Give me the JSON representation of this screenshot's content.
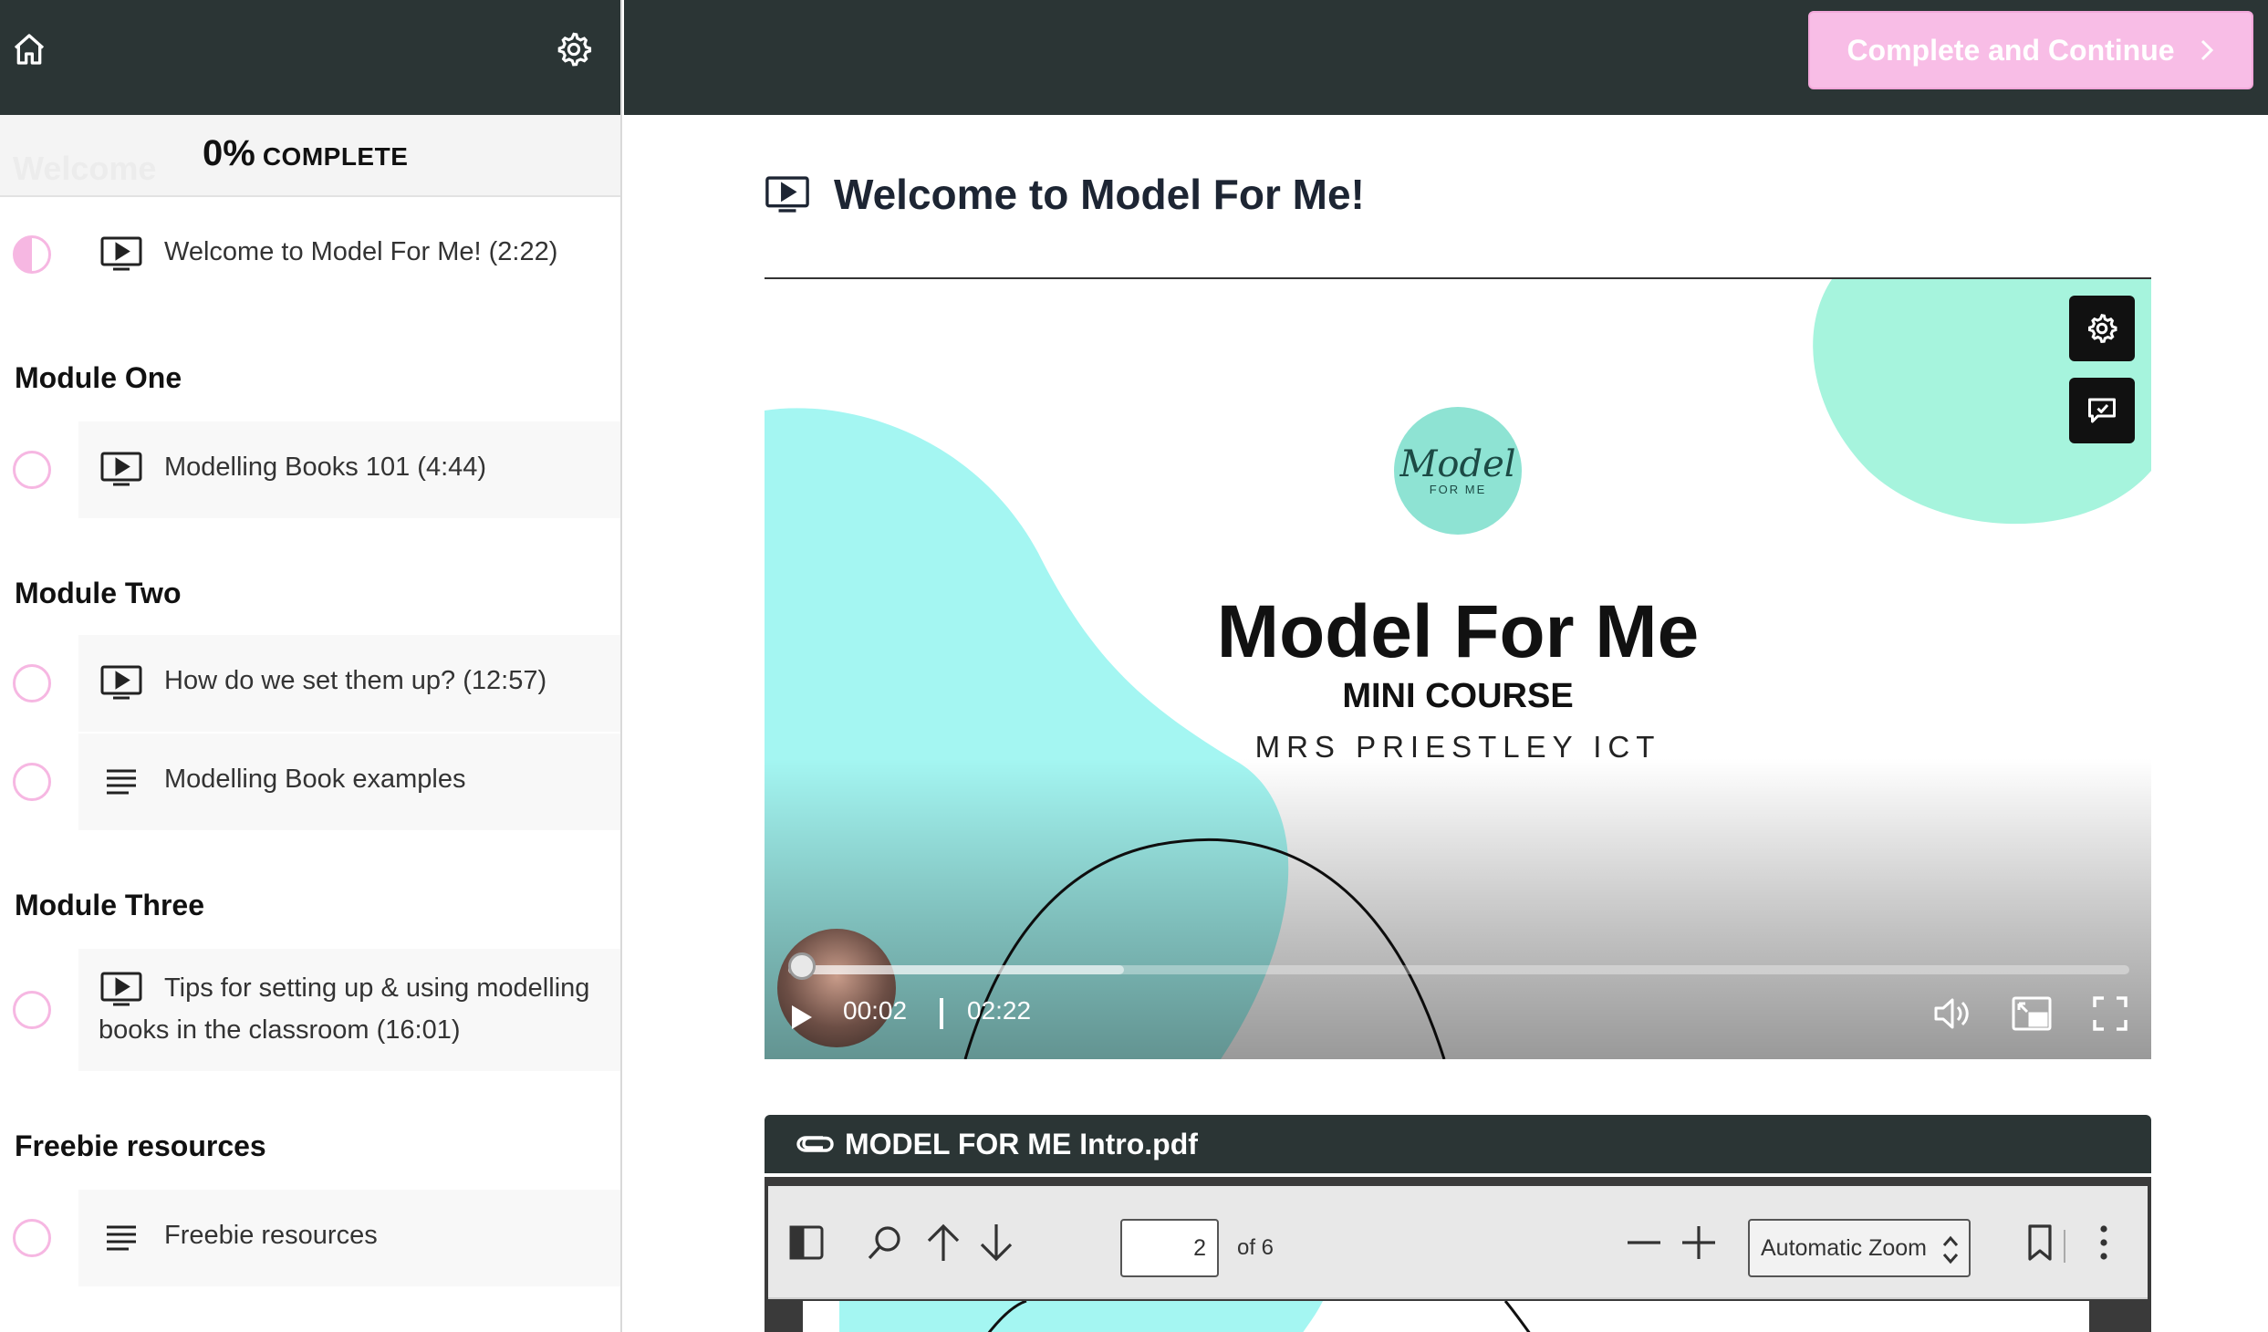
{
  "sidebar": {
    "progress_percent": "0%",
    "progress_label": "COMPLETE",
    "ghost_section": "Welcome",
    "lessons": [
      {
        "title": "Welcome to Model For Me! (2:22)",
        "type": "video",
        "status": "in-progress"
      },
      {
        "title": "Modelling Books 101 (4:44)",
        "type": "video",
        "status": "not-started"
      },
      {
        "title": "How do we set them up? (12:57)",
        "type": "video",
        "status": "not-started"
      },
      {
        "title": "Modelling Book examples",
        "type": "text",
        "status": "not-started"
      },
      {
        "title": "Tips for setting up & using modelling books in the classroom (16:01)",
        "type": "video",
        "status": "not-started"
      },
      {
        "title": "Freebie resources",
        "type": "text",
        "status": "not-started"
      }
    ],
    "sections": [
      "Module One",
      "Module Two",
      "Module Three",
      "Freebie resources"
    ]
  },
  "header": {
    "continue_label": "Complete and Continue",
    "continue_color": "#f8bde6"
  },
  "main": {
    "lesson_title": "Welcome to Model For Me!",
    "video": {
      "badge_main": "Model",
      "badge_sub": "FOR ME",
      "slide_title": "Model For Me",
      "slide_subtitle": "MINI COURSE",
      "slide_author": "MRS PRIESTLEY ICT",
      "current_time": "00:02",
      "duration": "02:22",
      "progress": 0.01,
      "buffered": 0.25
    },
    "attachment": {
      "file_name": "MODEL FOR ME Intro.pdf",
      "page": "2",
      "page_count_label": "of 6",
      "zoom": "Automatic Zoom"
    }
  },
  "colors": {
    "dark_bar": "#2b3535",
    "accent_pink": "#f6b7e2",
    "aqua": "#a4f6f2",
    "mint": "#a6f4dd"
  }
}
